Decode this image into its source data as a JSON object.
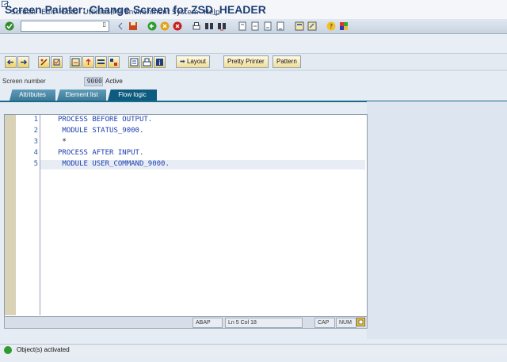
{
  "menu": [
    "Screen",
    "Edit",
    "Goto",
    "Utilities(M)",
    "Environment",
    "System",
    "Help"
  ],
  "icons": {
    "enter": "check-icon",
    "save": "floppy-icon",
    "back": "back-icon",
    "exit": "exit-icon",
    "cancel": "cancel-icon",
    "print": "print-icon",
    "find": "find-icon",
    "find_next": "find-next-icon",
    "first_page": "first-page-icon",
    "prev_page": "prev-page-icon",
    "next_page": "next-page-icon",
    "last_page": "last-page-icon",
    "new_session": "new-session-icon",
    "shortcut": "shortcut-icon",
    "help": "help-icon",
    "layout": "customize-layout-icon"
  },
  "colors": {
    "title": "#1e3f73",
    "tab_active": "#0d5b7e",
    "code_keyword": "#1b3fb0",
    "ok": "#2f9a2f"
  },
  "title": "Screen Painter: Change Screen for ZSD_HEADER",
  "app_toolbar": {
    "layout": "Layout",
    "pretty_printer": "Pretty Printer",
    "pattern": "Pattern",
    "layout_icon": "arrow-right-icon"
  },
  "screen": {
    "label": "Screen number",
    "number": "9000",
    "status": "Active"
  },
  "tabs": [
    "Attributes",
    "Element list",
    "Flow logic"
  ],
  "active_tab": "Flow logic",
  "code": [
    {
      "n": "1",
      "text": "PROCESS BEFORE OUTPUT."
    },
    {
      "n": "2",
      "text": " MODULE STATUS_9000."
    },
    {
      "n": "3",
      "text": " *"
    },
    {
      "n": "4",
      "text": "PROCESS AFTER INPUT."
    },
    {
      "n": "5",
      "text": " MODULE USER_COMMAND_9000."
    }
  ],
  "editor_status": {
    "lang": "ABAP",
    "pos_label": "Ln",
    "line": "5",
    "col_label": "Col",
    "col": "18",
    "caps": "CAP",
    "num": "NUM"
  },
  "status_message": "Object(s) activated"
}
